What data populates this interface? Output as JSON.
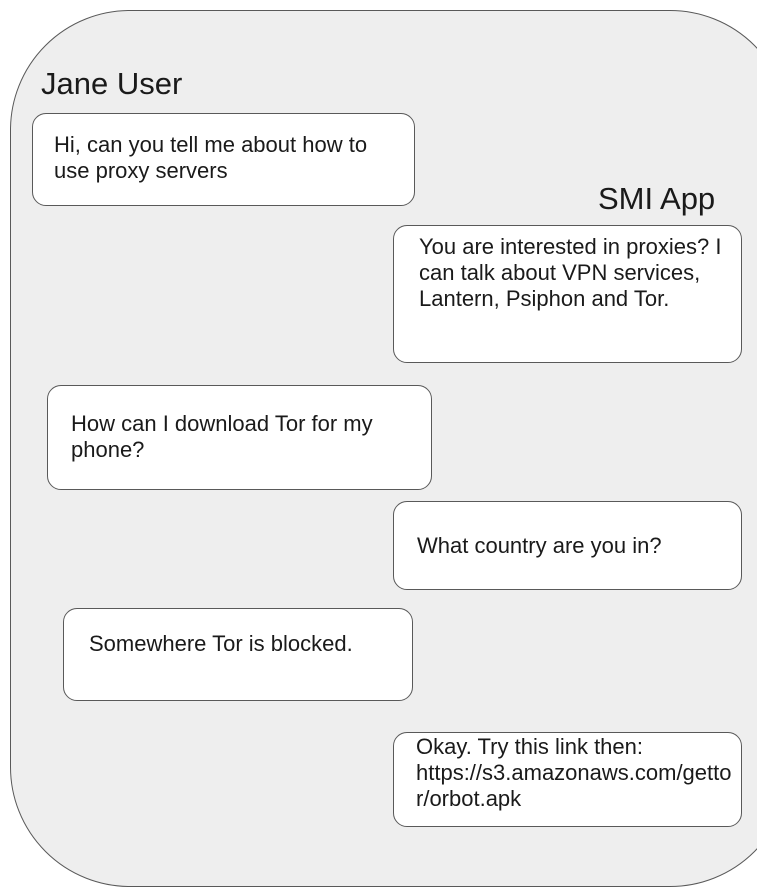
{
  "user_name": "Jane User",
  "app_name": "SMI App",
  "messages": [
    {
      "from": "user",
      "text": "Hi, can you tell me about how to use proxy servers"
    },
    {
      "from": "app",
      "text": "You are interested in proxies? I can talk about VPN services, Lantern, Psiphon and Tor."
    },
    {
      "from": "user",
      "text": "How can I download Tor for my phone?"
    },
    {
      "from": "app",
      "text": "What country are you in?"
    },
    {
      "from": "user",
      "text": "Somewhere Tor is blocked."
    },
    {
      "from": "app",
      "text": "Okay. Try this link then: https://s3.amazonaws.com/gettor/orbot.apk"
    }
  ],
  "colors": {
    "panel": "#eeeeee",
    "bubble": "#ffffff",
    "border": "#595959",
    "text": "#1a1a1a"
  }
}
